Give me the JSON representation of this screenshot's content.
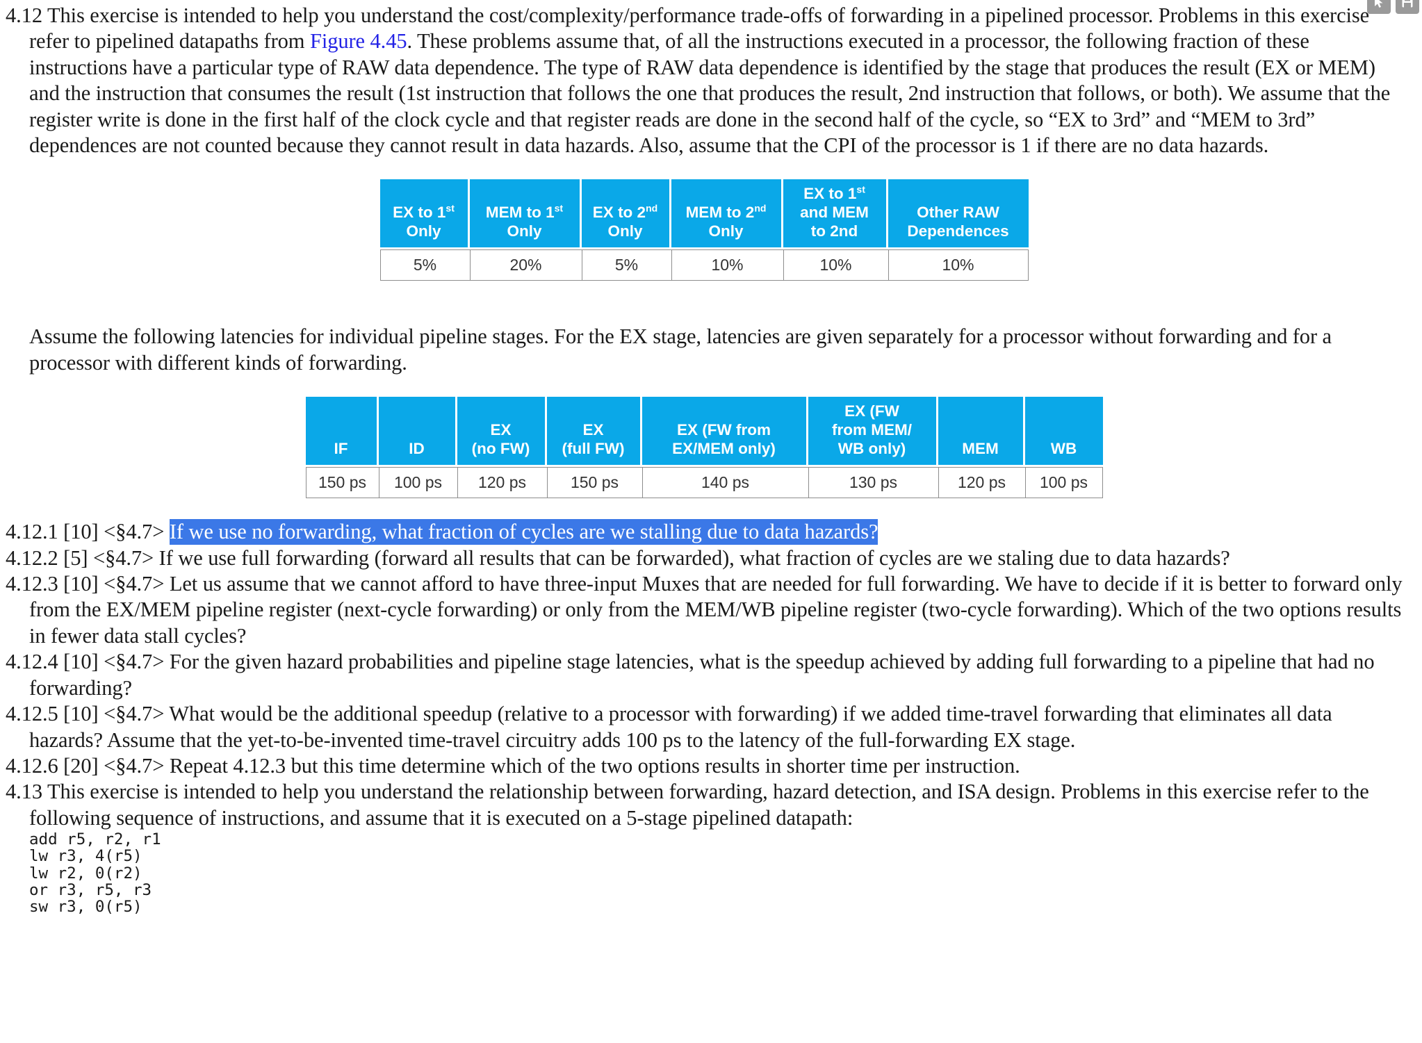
{
  "overlay": {
    "buttons": [
      {
        "name": "cursor-select-icon",
        "glyph": "cursor"
      },
      {
        "name": "save-icon",
        "glyph": "save"
      }
    ]
  },
  "exercise_412": {
    "number": "4.12",
    "intro_part1": "4.12 This exercise is intended to help you understand the cost/complexity/performance trade-offs of forwarding in a pipelined processor. Problems in this exercise refer to pipelined datapaths from ",
    "figure_link": "Figure 4.45",
    "intro_part2": ". These problems assume that, of all the instructions executed in a processor, the following fraction of these instructions have a particular type of RAW data dependence. The type of RAW data dependence is identified by the stage that produces the result (EX or MEM) and the instruction that consumes the result (1st instruction that follows the one that produces the result, 2nd instruction that follows, or both). We assume that the register write is done in the first half of the clock cycle and that register reads are done in the second half of the cycle, so “EX to 3rd” and “MEM to 3rd” dependences are not counted because they cannot result in data hazards. Also, assume that the CPI of the processor is 1 if there are no data hazards.",
    "latency_intro": "Assume the following latencies for individual pipeline stages. For the EX stage, latencies are given separately for a processor without forwarding and for a processor with different kinds of forwarding."
  },
  "hazard_table": {
    "headers": [
      {
        "line1": "EX to 1",
        "sup1": "st",
        "line2": "Only",
        "line3": ""
      },
      {
        "line1": "MEM to 1",
        "sup1": "st",
        "line2": "Only",
        "line3": ""
      },
      {
        "line1": "EX to 2",
        "sup1": "nd",
        "line2": "Only",
        "line3": ""
      },
      {
        "line1": "MEM to 2",
        "sup1": "nd",
        "line2": "Only",
        "line3": ""
      },
      {
        "line1": "EX to 1",
        "sup1": "st",
        "line2": "and MEM",
        "line3": "to 2nd"
      },
      {
        "line1": "Other RAW",
        "sup1": "",
        "line2": "Dependences",
        "line3": ""
      }
    ],
    "values": [
      "5%",
      "20%",
      "5%",
      "10%",
      "10%",
      "10%"
    ]
  },
  "latency_table": {
    "headers": [
      {
        "line1": "",
        "line2": "",
        "line3": "IF"
      },
      {
        "line1": "",
        "line2": "",
        "line3": "ID"
      },
      {
        "line1": "",
        "line2": "EX",
        "line3": "(no FW)"
      },
      {
        "line1": "",
        "line2": "EX",
        "line3": "(full FW)"
      },
      {
        "line1": "",
        "line2": "EX (FW from",
        "line3": "EX/MEM only)"
      },
      {
        "line1": "EX (FW",
        "line2": "from MEM/",
        "line3": "WB only)"
      },
      {
        "line1": "",
        "line2": "",
        "line3": "MEM"
      },
      {
        "line1": "",
        "line2": "",
        "line3": "WB"
      }
    ],
    "values": [
      "150 ps",
      "100 ps",
      "120 ps",
      "150 ps",
      "140 ps",
      "130 ps",
      "120 ps",
      "100 ps"
    ]
  },
  "subproblems": [
    {
      "id": "4.12.1",
      "label": "4.12.1 [10] <§4.7> ",
      "highlighted": "If we use no forwarding, what fraction of cycles are we stalling due to data hazards?",
      "rest": ""
    },
    {
      "id": "4.12.2",
      "label": "4.12.2 [5] <§4.7> ",
      "highlighted": "",
      "rest": "If we use full forwarding (forward all results that can be forwarded), what fraction of cycles are we staling due to data hazards?"
    },
    {
      "id": "4.12.3",
      "label": "4.12.3 [10] <§4.7> ",
      "highlighted": "",
      "rest": "Let us assume that we cannot afford to have three-input Muxes that are needed for full forwarding. We have to decide if it is better to forward only from the EX/MEM pipeline register (next-cycle forwarding) or only from the MEM/WB pipeline register (two-cycle forwarding). Which of the two options results in fewer data stall cycles?"
    },
    {
      "id": "4.12.4",
      "label": "4.12.4 [10] <§4.7> ",
      "highlighted": "",
      "rest": "For the given hazard probabilities and pipeline stage latencies, what is the speedup achieved by adding full forwarding to a pipeline that had no forwarding?"
    },
    {
      "id": "4.12.5",
      "label": "4.12.5 [10] <§4.7> ",
      "highlighted": "",
      "rest": "What would be the additional speedup (relative to a processor with forwarding) if we added time-travel forwarding that eliminates all data hazards? Assume that the yet-to-be-invented time-travel circuitry adds 100 ps to the latency of the full-forwarding EX stage."
    },
    {
      "id": "4.12.6",
      "label": "4.12.6 [20] <§4.7> ",
      "highlighted": "",
      "rest": "Repeat 4.12.3 but this time determine which of the two options results in shorter time per instruction."
    }
  ],
  "exercise_413": {
    "text": "4.13 This exercise is intended to help you understand the relationship between forwarding, hazard detection, and ISA design. Problems in this exercise refer to the following sequence of instructions, and assume that it is executed on a 5-stage pipelined datapath:",
    "code": [
      "add r5, r2, r1",
      "lw r3, 4(r5)",
      "lw r2, 0(r2)",
      "or r3, r5, r3",
      "sw r3, 0(r5)"
    ]
  },
  "colors": {
    "table_header_blue": "#0aa8e8",
    "selection_blue": "#3b78e7",
    "link_blue": "#2323e6",
    "overlay_grey": "#9a9a9a"
  }
}
